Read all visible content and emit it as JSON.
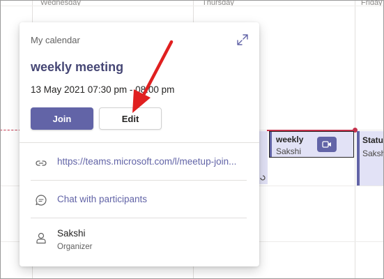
{
  "calendar": {
    "day_headers": [
      "Wednesday",
      "Thursday",
      "Friday"
    ],
    "events": {
      "weekly": {
        "title": "weekly",
        "organizer": "Sakshi"
      },
      "status": {
        "title": "Status",
        "organizer": "Sakshi"
      }
    },
    "now_indicator_color": "#c4314b"
  },
  "popup": {
    "section_label": "My calendar",
    "title": "weekly meeting",
    "time": "13 May 2021 07:30 pm - 08:00 pm",
    "join_label": "Join",
    "edit_label": "Edit",
    "link": "https://teams.microsoft.com/l/meetup-join...",
    "chat_label": "Chat with participants",
    "organizer_name": "Sakshi",
    "organizer_role": "Organizer"
  },
  "icons": {
    "expand": "expand-icon",
    "link": "link-icon",
    "chat": "chat-icon",
    "person": "person-icon",
    "teams": "teams-video-icon"
  },
  "colors": {
    "accent": "#6264a7",
    "annotation": "#e02020"
  }
}
